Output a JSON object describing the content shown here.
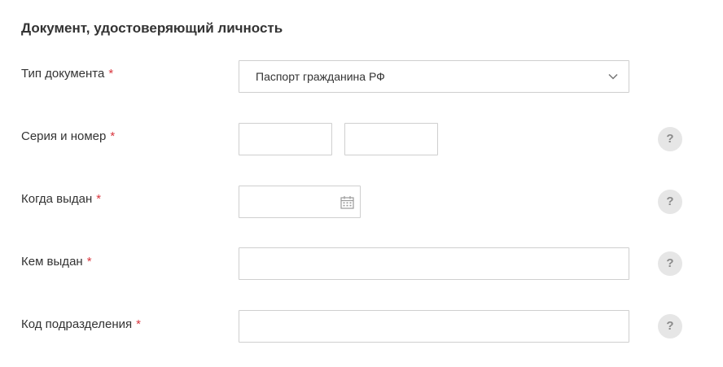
{
  "section": {
    "title": "Документ, удостоверяющий личность"
  },
  "required_mark": "*",
  "fields": {
    "doc_type": {
      "label": "Тип документа",
      "value": "Паспорт гражданина РФ"
    },
    "series_number": {
      "label": "Серия и номер",
      "series_value": "",
      "number_value": ""
    },
    "issue_date": {
      "label": "Когда выдан",
      "value": ""
    },
    "issued_by": {
      "label": "Кем выдан",
      "value": ""
    },
    "division_code": {
      "label": "Код подразделения",
      "value": ""
    }
  },
  "help": {
    "glyph": "?"
  },
  "colors": {
    "required": "#d9363e",
    "border": "#cfcfcf",
    "help_bg": "#e6e6e6",
    "help_fg": "#8a8a8a"
  },
  "icons": {
    "select": "chevron-down-icon",
    "date": "calendar-icon",
    "help": "question-mark-icon"
  }
}
